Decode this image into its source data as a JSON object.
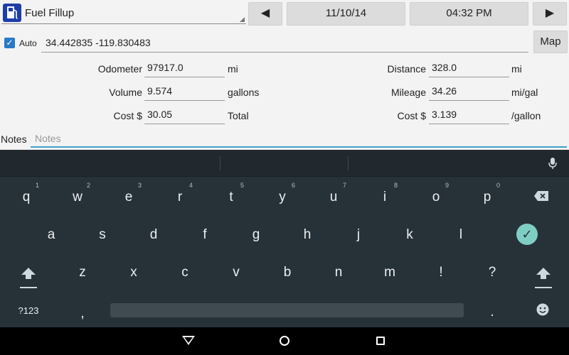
{
  "header": {
    "vehicle": "Fuel Fillup",
    "prev_label": "◀",
    "date": "11/10/14",
    "time": "04:32 PM",
    "next_label": "▶"
  },
  "location": {
    "auto_label": "Auto",
    "auto_checked": true,
    "coords": "34.442835 -119.830483",
    "map_label": "Map"
  },
  "fields": {
    "odometer": {
      "label": "Odometer",
      "value": "97917.0",
      "unit": "mi"
    },
    "volume": {
      "label": "Volume",
      "value": "9.574",
      "unit": "gallons"
    },
    "cost": {
      "label": "Cost $",
      "value": "30.05",
      "unit": "Total"
    },
    "distance": {
      "label": "Distance",
      "value": "328.0",
      "unit": "mi"
    },
    "mileage": {
      "label": "Mileage",
      "value": "34.26",
      "unit": "mi/gal"
    },
    "unit_cost": {
      "label": "Cost $",
      "value": "3.139",
      "unit": "/gallon"
    }
  },
  "notes": {
    "label": "Notes",
    "placeholder": "Notes"
  },
  "keyboard": {
    "row1": [
      {
        "k": "q",
        "h": "1"
      },
      {
        "k": "w",
        "h": "2"
      },
      {
        "k": "e",
        "h": "3"
      },
      {
        "k": "r",
        "h": "4"
      },
      {
        "k": "t",
        "h": "5"
      },
      {
        "k": "y",
        "h": "6"
      },
      {
        "k": "u",
        "h": "7"
      },
      {
        "k": "i",
        "h": "8"
      },
      {
        "k": "o",
        "h": "9"
      },
      {
        "k": "p",
        "h": "0"
      }
    ],
    "row2": [
      "a",
      "s",
      "d",
      "f",
      "g",
      "h",
      "j",
      "k",
      "l"
    ],
    "row3": [
      "z",
      "x",
      "c",
      "v",
      "b",
      "n",
      "m",
      "!",
      "?"
    ],
    "sym_label": "?123",
    "comma": ",",
    "period": ".",
    "accent_color": "#7ecec4"
  }
}
